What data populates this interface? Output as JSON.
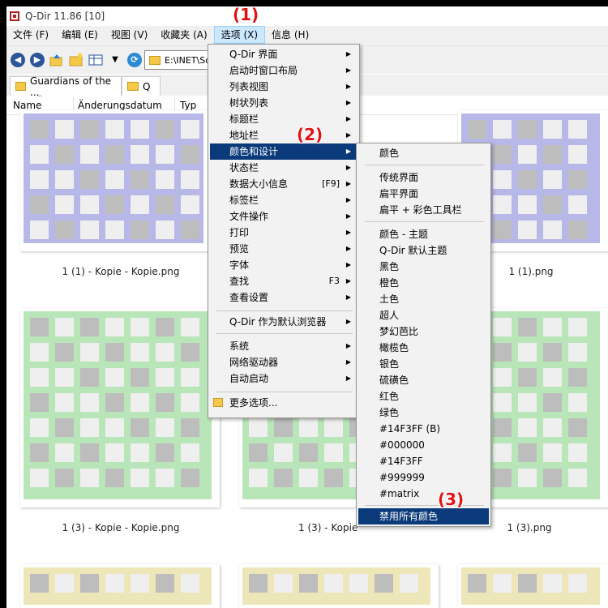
{
  "window": {
    "title": "Q-Dir 11.86 [10]"
  },
  "menubar": [
    {
      "label": "文件 (F)"
    },
    {
      "label": "编辑 (E)"
    },
    {
      "label": "视图 (V)"
    },
    {
      "label": "收藏夹 (A)"
    },
    {
      "label": "选项 (X)"
    },
    {
      "label": "信息 (H)"
    }
  ],
  "address": {
    "path": "E:\\INET\\So"
  },
  "tabs": [
    {
      "label": "Guardians of the ..."
    },
    {
      "label": "Q"
    }
  ],
  "columns": [
    "Name",
    "Änderungsdatum",
    "Typ"
  ],
  "files": [
    {
      "name": "1 (1) - Kopie - Kopie.png"
    },
    {
      "name": "1 (1).png"
    },
    {
      "name": "1 (3) - Kopie - Kopie.png"
    },
    {
      "name": "1 (3) - Kopie"
    },
    {
      "name": "1 (3).png"
    }
  ],
  "options_menu": {
    "items": [
      {
        "label": "Q-Dir 界面",
        "arrow": true
      },
      {
        "label": "启动时窗口布局",
        "arrow": true
      },
      {
        "label": "列表视图",
        "arrow": true
      },
      {
        "label": "树状列表",
        "arrow": true
      },
      {
        "label": "标题栏",
        "arrow": true
      },
      {
        "label": "地址栏",
        "arrow": true
      },
      {
        "label": "颜色和设计",
        "arrow": true
      },
      {
        "label": "状态栏",
        "arrow": true
      },
      {
        "label": "数据大小信息",
        "shortcut": "[F9]",
        "arrow": true
      },
      {
        "label": "标签栏",
        "arrow": true
      },
      {
        "label": "文件操作",
        "arrow": true
      },
      {
        "label": "打印",
        "arrow": true
      },
      {
        "label": "预览",
        "arrow": true
      },
      {
        "label": "字体",
        "arrow": true
      },
      {
        "label": "查找",
        "shortcut": "F3",
        "arrow": true
      },
      {
        "label": "查看设置",
        "arrow": true
      },
      {
        "label": "Q-Dir 作为默认浏览器",
        "arrow": true
      },
      {
        "label": "系统",
        "arrow": true
      },
      {
        "label": "网络驱动器",
        "arrow": true
      },
      {
        "label": "自动启动",
        "arrow": true
      },
      {
        "label": "更多选项..."
      }
    ]
  },
  "color_submenu": {
    "items": [
      "颜色",
      "传统界面",
      "扁平界面",
      "扁平 + 彩色工具栏",
      "颜色 - 主题",
      "Q-Dir 默认主题",
      "黑色",
      "橙色",
      "土色",
      "超人",
      "梦幻芭比",
      "橄榄色",
      "银色",
      "硫磺色",
      "红色",
      "绿色",
      "#14F3FF (B)",
      "#000000",
      "#14F3FF",
      "#999999",
      "#matrix",
      "禁用所有颜色"
    ]
  },
  "markers": [
    "(1)",
    "(2)",
    "(3)"
  ],
  "colors": {
    "highlight": "#0a3a7a",
    "marker_red": "#e31212",
    "purple_thumb": "#b7b7e8",
    "green_thumb": "#b9e6b9",
    "yellow_thumb": "#ece6b8"
  }
}
